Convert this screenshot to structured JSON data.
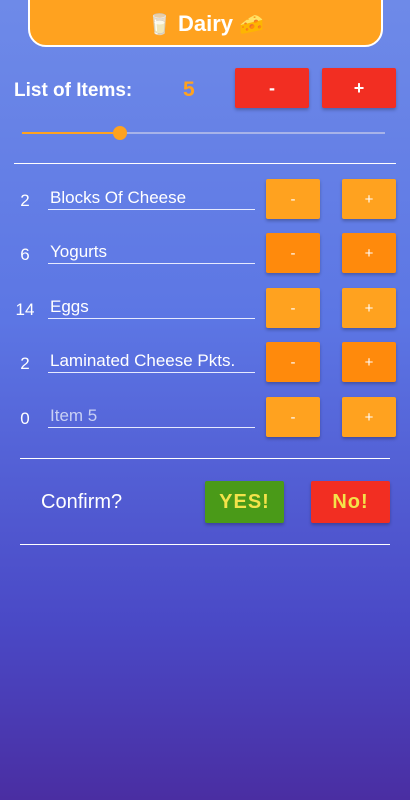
{
  "header": {
    "title": "Dairy",
    "left_icon": "🥛",
    "right_icon": "🧀"
  },
  "counter": {
    "label": "List of Items:",
    "value": "5",
    "minus_label": "-",
    "plus_label": "+"
  },
  "slider": {
    "value_fraction": 0.27
  },
  "items": [
    {
      "qty": "2",
      "name": "Blocks Of Cheese",
      "placeholder": "",
      "minus": "-",
      "plus": "+"
    },
    {
      "qty": "6",
      "name": "Yogurts",
      "placeholder": "",
      "minus": "-",
      "plus": "+"
    },
    {
      "qty": "14",
      "name": "Eggs",
      "placeholder": "",
      "minus": "-",
      "plus": "+"
    },
    {
      "qty": "2",
      "name": "Laminated Cheese Pkts.",
      "placeholder": "",
      "minus": "-",
      "plus": "+"
    },
    {
      "qty": "0",
      "name": "",
      "placeholder": "Item 5",
      "minus": "-",
      "plus": "+"
    }
  ],
  "confirm": {
    "label": "Confirm?",
    "yes_label": "YES!",
    "no_label": "No!"
  },
  "colors": {
    "accent_orange": "#ffa21f",
    "red": "#f22e22",
    "green": "#4a9a18",
    "yellow_text": "#f4e34a"
  }
}
